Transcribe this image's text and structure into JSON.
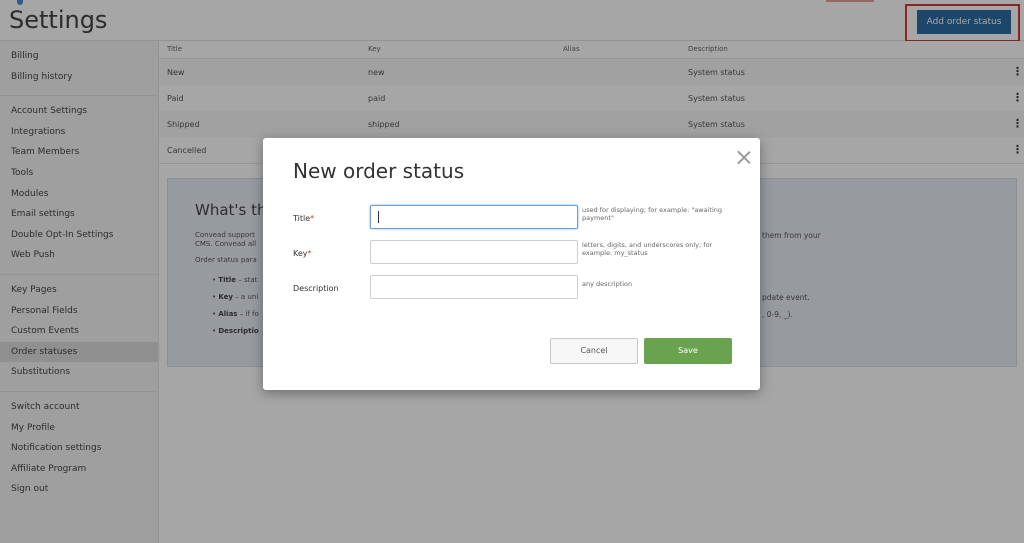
{
  "header": {
    "title": "Settings",
    "add_button": "Add order status"
  },
  "sidebar": {
    "groups": [
      [
        "Billing",
        "Billing history"
      ],
      [
        "Account Settings",
        "Integrations",
        "Team Members",
        "Tools",
        "Modules",
        "Email settings",
        "Double Opt-In Settings",
        "Web Push"
      ],
      [
        "Key Pages",
        "Personal Fields",
        "Custom Events",
        "Order statuses",
        "Substitutions"
      ],
      [
        "Switch account",
        "My Profile",
        "Notification settings",
        "Affiliate Program",
        "Sign out"
      ]
    ],
    "active": "Order statuses"
  },
  "table": {
    "headers": {
      "title": "Title",
      "key": "Key",
      "alias": "Alias",
      "description": "Description"
    },
    "rows": [
      {
        "title": "New",
        "key": "new",
        "alias": "",
        "description": "System status"
      },
      {
        "title": "Paid",
        "key": "paid",
        "alias": "",
        "description": "System status"
      },
      {
        "title": "Shipped",
        "key": "shipped",
        "alias": "",
        "description": "System status"
      },
      {
        "title": "Cancelled",
        "key": "",
        "alias": "",
        "description": ""
      }
    ]
  },
  "info": {
    "title": "What's thi",
    "p1_line1": "Convead support",
    "p1_line2": "CMS. Convead all",
    "p2": "Order status para",
    "items": [
      {
        "bold": "Title",
        "rest": " – stat"
      },
      {
        "bold": "Key",
        "rest": " – a uni"
      },
      {
        "bold": "Alias",
        "rest": " – if fo"
      },
      {
        "bold": "Descriptio",
        "rest": ""
      }
    ],
    "right_1": "them from your",
    "right_2": "pdate event.",
    "right_3": ", 0-9, _)."
  },
  "modal": {
    "title": "New order status",
    "fields": {
      "title": {
        "label": "Title",
        "required_mark": "*",
        "value": "",
        "hint": "used for displaying; for example: \"awaiting payment\""
      },
      "key": {
        "label": "Key",
        "required_mark": "*",
        "value": "",
        "hint": "letters, digits, and underscores only; for example: my_status"
      },
      "description": {
        "label": "Description",
        "value": "",
        "hint": "any description"
      }
    },
    "cancel": "Cancel",
    "save": "Save"
  },
  "colors": {
    "primary": "#2c6ca3",
    "save": "#6aa350",
    "highlight": "#d63a3a",
    "required": "#d9363e"
  }
}
